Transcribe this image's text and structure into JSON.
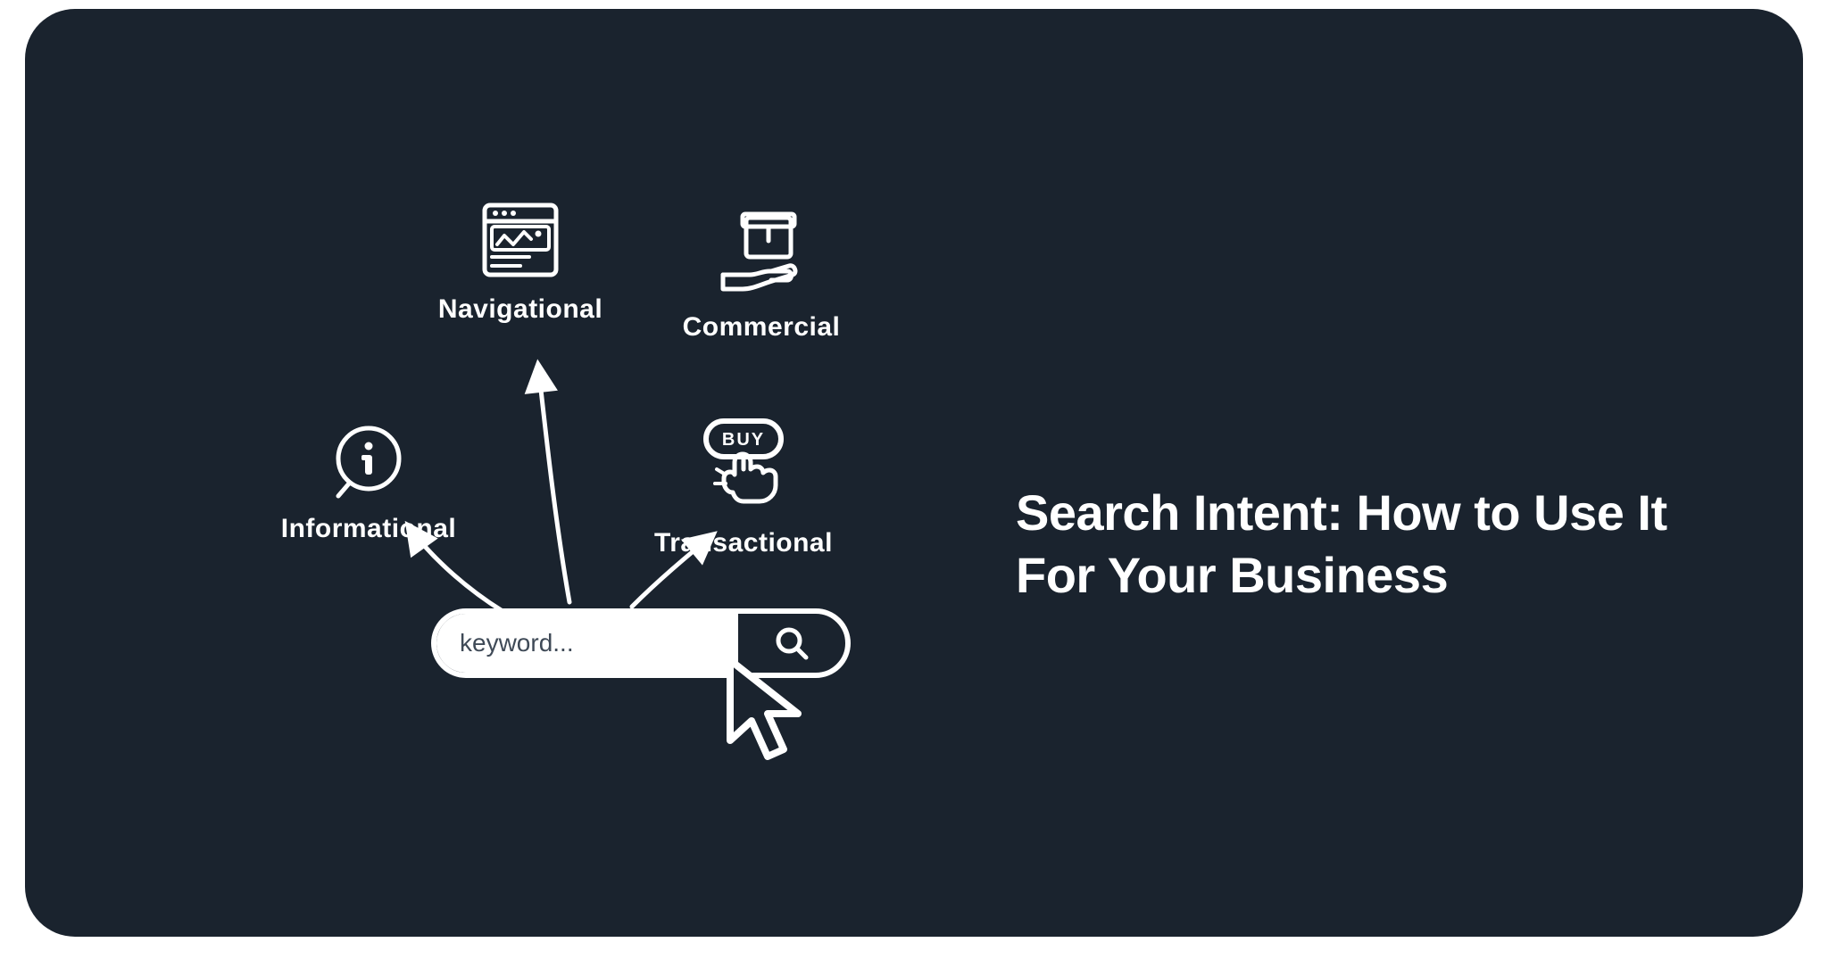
{
  "title": "Search Intent: How to Use It For Your Business",
  "search": {
    "placeholder": "keyword..."
  },
  "intents": {
    "informational": {
      "label": "Informational"
    },
    "navigational": {
      "label": "Navigational"
    },
    "commercial": {
      "label": "Commercial"
    },
    "transactional": {
      "label": "Transactional",
      "buy_text": "BUY"
    }
  },
  "colors": {
    "bg": "#1a232e",
    "fg": "#ffffff",
    "placeholder": "#3f4a57"
  }
}
